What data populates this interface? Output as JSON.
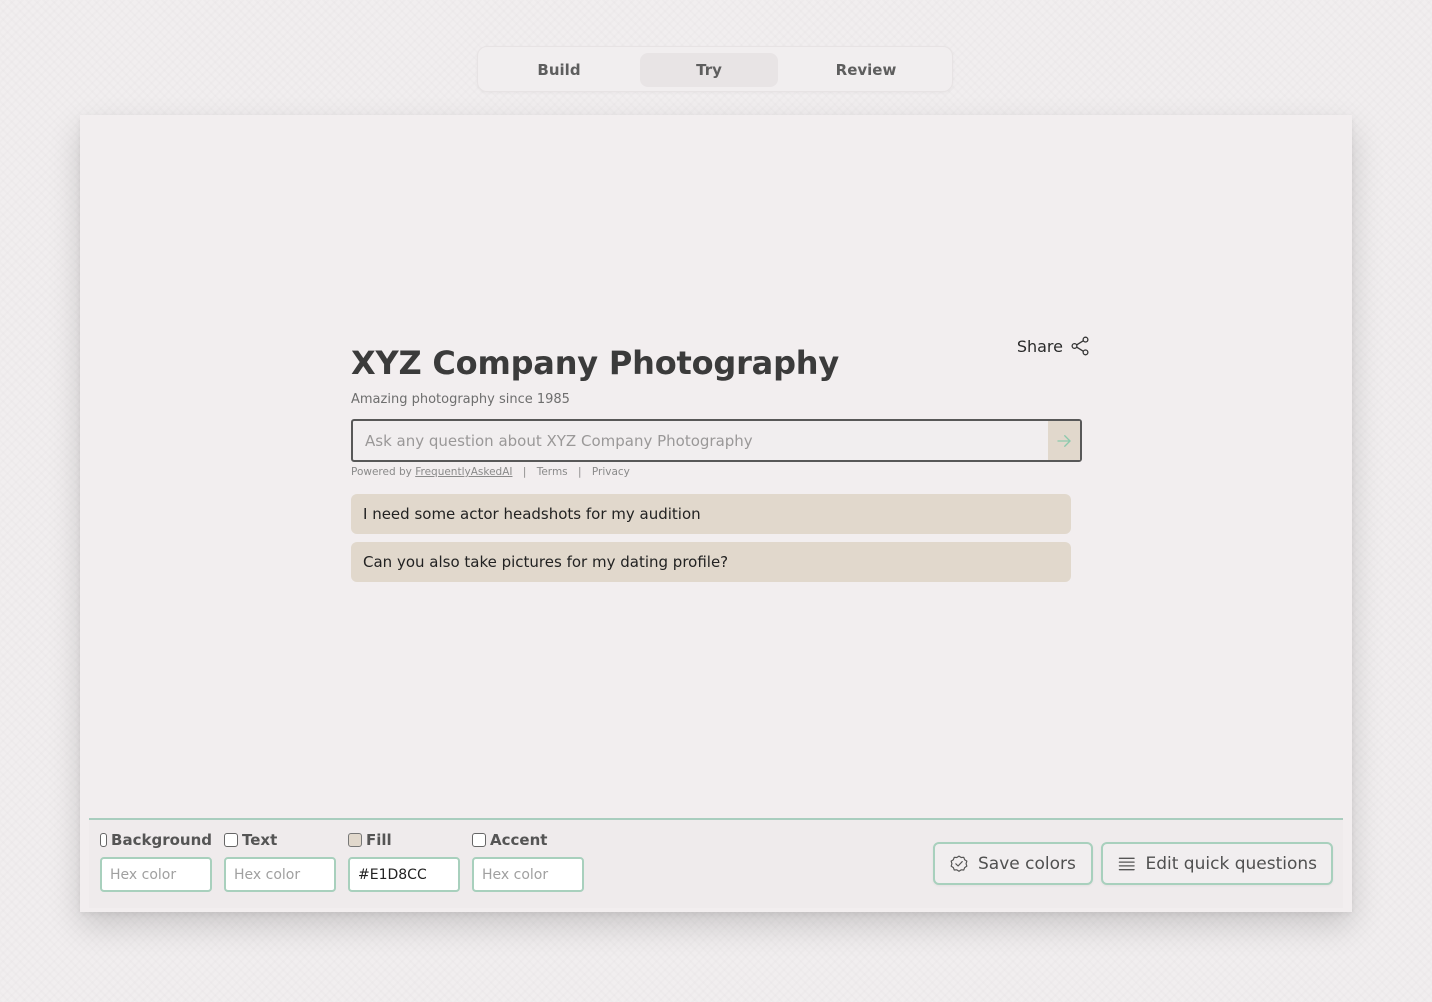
{
  "tabs": [
    {
      "label": "Build"
    },
    {
      "label": "Try"
    },
    {
      "label": "Review"
    }
  ],
  "widget": {
    "share_label": "Share",
    "title": "XYZ Company Photography",
    "subtitle": "Amazing photography since 1985",
    "search_placeholder": "Ask any question about XYZ Company Photography",
    "powered_by": "Powered by",
    "powered_link": "FrequentlyAskedAI",
    "separator": "|",
    "terms": "Terms",
    "privacy": "Privacy",
    "quick_questions": [
      "I need some actor headshots for my audition",
      "Can you also take pictures for my dating profile?"
    ]
  },
  "toolbar": {
    "background": {
      "label": "Background",
      "placeholder": "Hex color",
      "value": ""
    },
    "text": {
      "label": "Text",
      "placeholder": "Hex color",
      "value": ""
    },
    "fill": {
      "label": "Fill",
      "placeholder": "Hex color",
      "value": "#E1D8CC"
    },
    "accent": {
      "label": "Accent",
      "placeholder": "Hex color",
      "value": ""
    },
    "save_label": "Save colors",
    "edit_label": "Edit quick questions"
  },
  "colors": {
    "fill": "#E1D8CC",
    "accent_border": "#A8D0BD",
    "send_arrow": "#8cc9ad"
  },
  "icons": {
    "share": "share-icon",
    "send": "arrow-right-icon",
    "save": "check-badge-icon",
    "edit": "list-icon"
  }
}
